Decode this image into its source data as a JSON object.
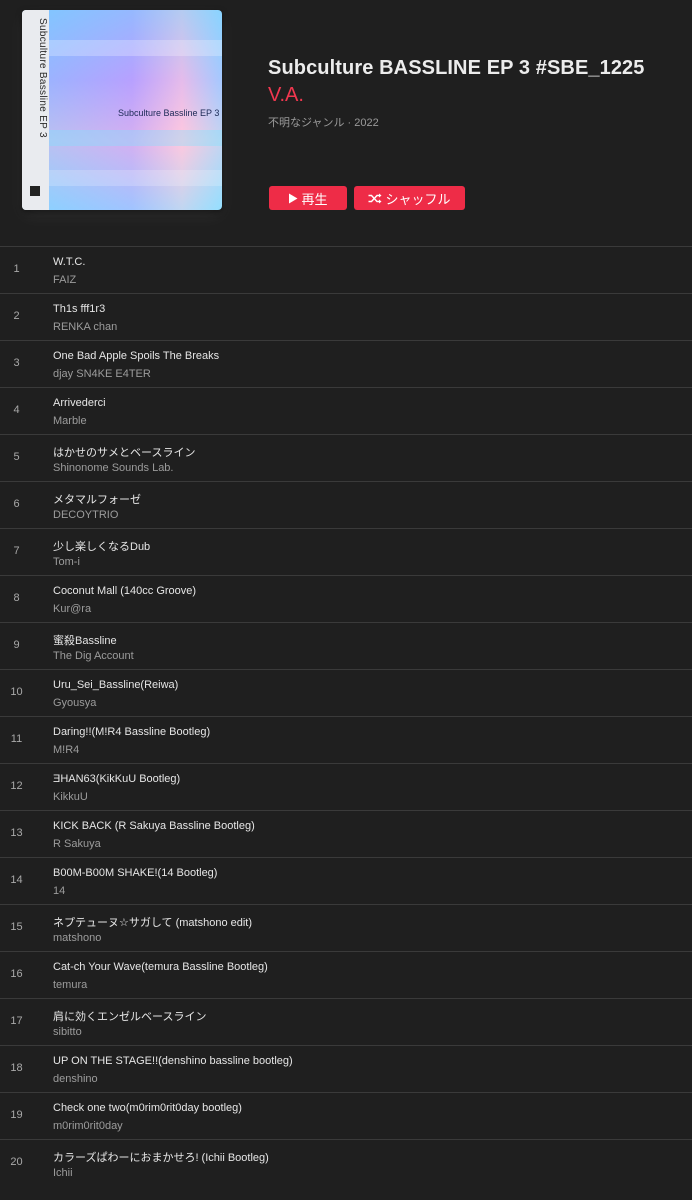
{
  "album": {
    "title": "Subculture BASSLINE EP 3 #SBE_1225",
    "artist": "V.A.",
    "meta": "不明なジャンル · 2022",
    "artwork_title": "Subculture Bassline EP 3",
    "artwork_sidebar": "Subculture Bassline EP 3"
  },
  "buttons": {
    "play_label": "再生",
    "shuffle_label": "シャッフル",
    "accent_color": "#ee2c47"
  },
  "tracks": [
    {
      "num": "1",
      "title": "W.T.C.",
      "artist": "FAIZ"
    },
    {
      "num": "2",
      "title": "Th1s fff1r3",
      "artist": "RENKA chan"
    },
    {
      "num": "3",
      "title": "One Bad Apple Spoils The Breaks",
      "artist": "djay SN4KE E4TER"
    },
    {
      "num": "4",
      "title": "Arrivederci",
      "artist": "Marble"
    },
    {
      "num": "5",
      "title": "はかせのサメとベースライン",
      "artist": "Shinonome Sounds Lab."
    },
    {
      "num": "6",
      "title": "メタマルフォーゼ",
      "artist": "DECOYTRIO"
    },
    {
      "num": "7",
      "title": "少し楽しくなるDub",
      "artist": "Tom-i"
    },
    {
      "num": "8",
      "title": "Coconut Mall (140cc Groove)",
      "artist": "Kur@ra"
    },
    {
      "num": "9",
      "title": "蜜殺Bassline",
      "artist": "The Dig Account"
    },
    {
      "num": "10",
      "title": "Uru_Sei_Bassline(Reiwa)",
      "artist": "Gyousya"
    },
    {
      "num": "11",
      "title": "Daring!!(M!R4 Bassline Bootleg)",
      "artist": "M!R4"
    },
    {
      "num": "12",
      "title": "ƎHAN63(KikKuU Bootleg)",
      "artist": "KikkuU"
    },
    {
      "num": "13",
      "title": "KICK BACK (R Sakuya Bassline Bootleg)",
      "artist": "R Sakuya"
    },
    {
      "num": "14",
      "title": "B00M-B00M SHAKE!(14 Bootleg)",
      "artist": "14"
    },
    {
      "num": "15",
      "title": "ネプテューヌ☆サガして (matshono edit)",
      "artist": "matshono"
    },
    {
      "num": "16",
      "title": "Cat-ch Your Wave(temura Bassline Bootleg)",
      "artist": "temura"
    },
    {
      "num": "17",
      "title": "肩に効くエンゼルベースライン",
      "artist": "sibitto"
    },
    {
      "num": "18",
      "title": "UP ON THE STAGE!!(denshino bassline bootleg)",
      "artist": "denshino"
    },
    {
      "num": "19",
      "title": "Check one two(m0rim0rit0day bootleg)",
      "artist": "m0rim0rit0day"
    },
    {
      "num": "20",
      "title": "カラーズぱわーにおまかせろ! (Ichii Bootleg)",
      "artist": "Ichii"
    }
  ]
}
